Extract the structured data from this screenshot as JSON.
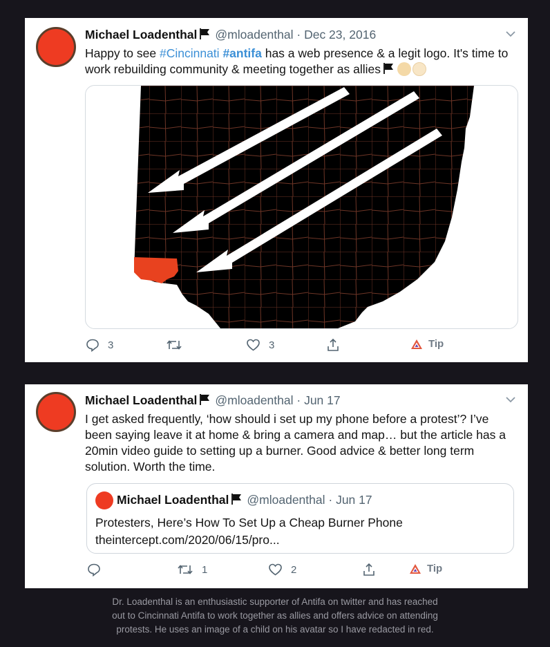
{
  "tweet1": {
    "display_name": "Michael Loadenthal",
    "handle": "@mloadenthal",
    "separator": "·",
    "date": "Dec 23, 2016",
    "text_intro": "Happy to see ",
    "hashtag1": "#Cincinnati",
    "hashtag2": "#antifa",
    "text_rest": " has a web presence & a legit logo. It's time to work rebuilding community & meeting together as allies",
    "media_icon": "ohio-map-arrows-logo",
    "reply_count": "3",
    "retweet_count": "",
    "like_count": "3",
    "tip_label": "Tip"
  },
  "tweet2": {
    "display_name": "Michael Loadenthal",
    "handle": "@mloadenthal",
    "separator": "·",
    "date": "Jun 17",
    "text": "I get asked frequently, ‘how should i set up my phone before a protest’? I’ve been saying leave it at home & bring a camera and map… but the article has a 20min video guide to setting up a burner. Good advice & better long term solution. Worth the time.",
    "quote": {
      "display_name": "Michael Loadenthal",
      "handle": "@mloadenthal",
      "separator": "·",
      "date": "Jun 17",
      "line1": "Protesters, Here’s How To Set Up a Cheap Burner Phone",
      "line2": "theintercept.com/2020/06/15/pro..."
    },
    "reply_count": "",
    "retweet_count": "1",
    "like_count": "2",
    "tip_label": "Tip"
  },
  "caption": {
    "line1": "Dr. Loadenthal is an enthusiastic supporter of Antifa on twitter and has reached",
    "line2": "out to Cincinnati Antifa to work together as allies and offers advice on attending",
    "line3": "protests. He uses an image of a child on his avatar so I have redacted in red."
  },
  "colors": {
    "background": "#17151c",
    "hashtag": "#3b8fd6",
    "redaction": "#ee3b22",
    "map_county": "#000000",
    "map_border": "#7a3a2a",
    "highlight_county": "#e8421f"
  }
}
